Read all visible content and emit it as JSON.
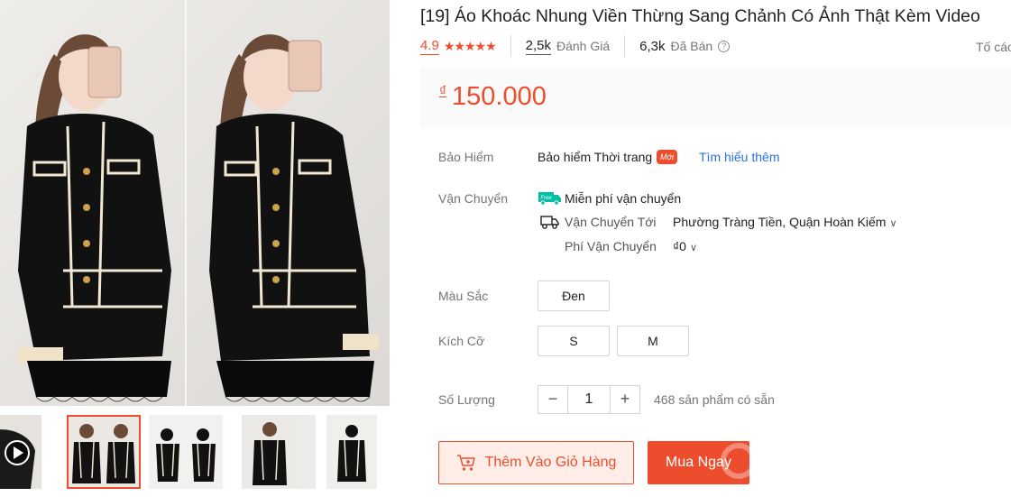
{
  "product": {
    "title": "[19] Áo Khoác Nhung Viền Thừng Sang Chảnh Có Ảnh Thật Kèm Video"
  },
  "stats": {
    "rating": "4.9",
    "stars": "★★★★★",
    "reviews_count": "2,5k",
    "reviews_label": "Đánh Giá",
    "sold_count": "6,3k",
    "sold_label": "Đã Bán",
    "report_label": "Tố cáo"
  },
  "price": {
    "currency": "₫",
    "value": "150.000"
  },
  "insurance": {
    "label": "Bảo Hiểm",
    "name": "Bảo hiểm Thời trang",
    "badge": "Mới",
    "link": "Tìm hiểu thêm"
  },
  "shipping": {
    "label": "Vận Chuyển",
    "free_badge": "Free",
    "free_text": "Miễn phí vận chuyển",
    "to_label": "Vận Chuyển Tới",
    "to_value": "Phường Tràng Tiền, Quận Hoàn Kiếm",
    "fee_label": "Phí Vận Chuyển",
    "fee_value": "₫0"
  },
  "color": {
    "label": "Màu Sắc",
    "options": [
      "Đen"
    ]
  },
  "size": {
    "label": "Kích Cỡ",
    "options": [
      "S",
      "M"
    ]
  },
  "quantity": {
    "label": "Số Lượng",
    "minus": "−",
    "value": "1",
    "plus": "+",
    "stock": "468 sản phẩm có sẵn"
  },
  "actions": {
    "add_to_cart": "Thêm Vào Giỏ Hàng",
    "buy_now": "Mua Ngay"
  },
  "colors": {
    "accent": "#ee4d2d",
    "link": "#2673dd",
    "free_ship": "#00bfa5"
  }
}
